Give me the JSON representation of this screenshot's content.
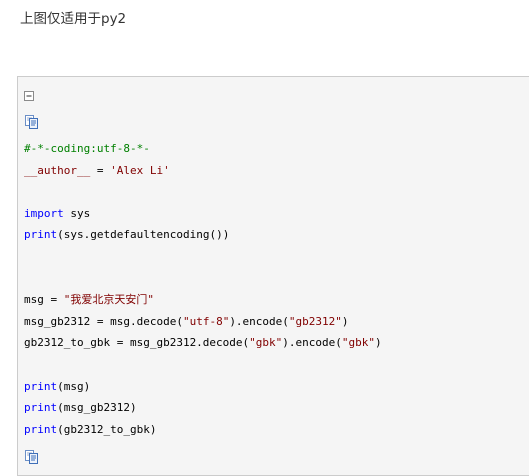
{
  "caption": "上图仅适用于py2",
  "code_block": {
    "icons": {
      "collapse": "collapse-minus-icon",
      "copy": "copy-code-icon"
    },
    "lines": [
      {
        "segments": [
          {
            "t": "#-*-coding:utf-8-*-",
            "c": "comment"
          }
        ]
      },
      {
        "segments": [
          {
            "t": "__author__",
            "c": "name-dunder"
          },
          {
            "t": " = ",
            "c": "plain"
          },
          {
            "t": "'Alex Li'",
            "c": "string"
          }
        ]
      },
      {
        "segments": []
      },
      {
        "segments": [
          {
            "t": "import",
            "c": "keyword"
          },
          {
            "t": " sys",
            "c": "plain"
          }
        ]
      },
      {
        "segments": [
          {
            "t": "print",
            "c": "builtin"
          },
          {
            "t": "(sys.getdefaultencoding())",
            "c": "plain"
          }
        ]
      },
      {
        "segments": []
      },
      {
        "segments": []
      },
      {
        "segments": [
          {
            "t": "msg = ",
            "c": "plain"
          },
          {
            "t": "\"我爱北京天安门\"",
            "c": "string"
          }
        ]
      },
      {
        "segments": [
          {
            "t": "msg_gb2312 = msg.decode(",
            "c": "plain"
          },
          {
            "t": "\"utf-8\"",
            "c": "string"
          },
          {
            "t": ").encode(",
            "c": "plain"
          },
          {
            "t": "\"gb2312\"",
            "c": "string"
          },
          {
            "t": ")",
            "c": "plain"
          }
        ]
      },
      {
        "segments": [
          {
            "t": "gb2312_to_gbk = msg_gb2312.decode(",
            "c": "plain"
          },
          {
            "t": "\"gbk\"",
            "c": "string"
          },
          {
            "t": ").encode(",
            "c": "plain"
          },
          {
            "t": "\"gbk\"",
            "c": "string"
          },
          {
            "t": ")",
            "c": "plain"
          }
        ]
      },
      {
        "segments": []
      },
      {
        "segments": [
          {
            "t": "print",
            "c": "builtin"
          },
          {
            "t": "(msg)",
            "c": "plain"
          }
        ]
      },
      {
        "segments": [
          {
            "t": "print",
            "c": "builtin"
          },
          {
            "t": "(msg_gb2312)",
            "c": "plain"
          }
        ]
      },
      {
        "segments": [
          {
            "t": "print",
            "c": "builtin"
          },
          {
            "t": "(gb2312_to_gbk)",
            "c": "plain"
          }
        ]
      }
    ]
  }
}
